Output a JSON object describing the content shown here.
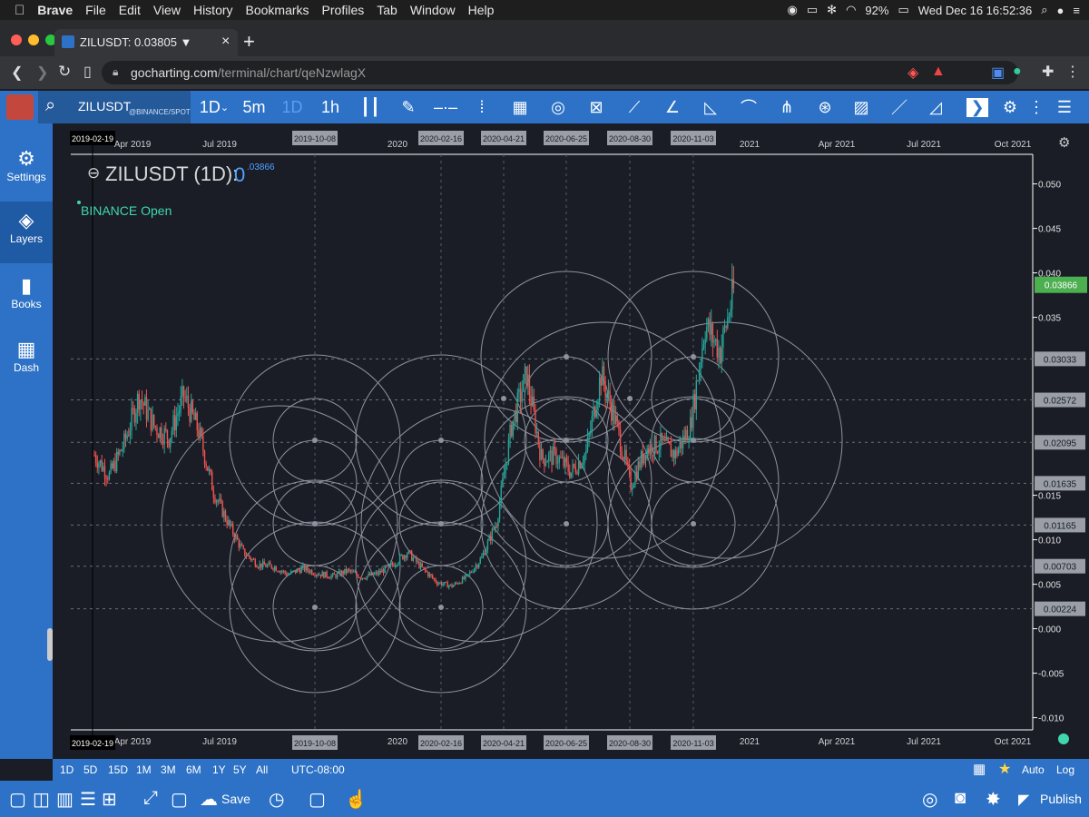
{
  "menubar": {
    "apple": "",
    "app": "Brave",
    "items": [
      "File",
      "Edit",
      "View",
      "History",
      "Bookmarks",
      "Profiles",
      "Tab",
      "Window",
      "Help"
    ],
    "battery": "92%",
    "clock": "Wed Dec 16  16:52:36"
  },
  "tab": {
    "title": "ZILUSDT: 0.03805 ▼",
    "close": "×",
    "new_tab": "+"
  },
  "address": {
    "url_host": "gocharting.com",
    "url_path": "/terminal/chart/qeNzwlagX"
  },
  "toolbar": {
    "symbol": "ZILUSDT",
    "exchange": "@BINANCE/SPOT",
    "interval": "1D",
    "intervals": [
      "5m",
      "1D",
      "1h"
    ]
  },
  "sidebar": {
    "items": [
      {
        "label": "Settings",
        "icon": "gear-icon"
      },
      {
        "label": "Layers",
        "icon": "layers-icon"
      },
      {
        "label": "Books",
        "icon": "book-icon"
      },
      {
        "label": "Dash",
        "icon": "dashboard-icon"
      }
    ]
  },
  "chart": {
    "title": "ZILUSDT (1D):",
    "price_prefix": "0",
    "price_sup": ".03866",
    "source": "BINANCE Open",
    "x_ticks": [
      "Apr 2019",
      "Jul 2019",
      "2020",
      "2021",
      "Apr 2021",
      "Jul 2021",
      "Oct 2021"
    ],
    "date_markers": [
      "2019-02-19",
      "2019-10-08",
      "2020-02-16",
      "2020-04-21",
      "2020-06-25",
      "2020-08-30",
      "2020-11-03"
    ],
    "y_ticks": [
      "0.050",
      "0.045",
      "0.040",
      "0.035",
      "0.015",
      "0.010",
      "0.005",
      "0.000",
      "-0.005",
      "-0.010"
    ],
    "level_labels": [
      "0.03033",
      "0.02572",
      "0.02095",
      "0.01635",
      "0.01165",
      "0.00703",
      "0.00224"
    ],
    "current_price": "0.03866",
    "colors": {
      "up": "#26a69a",
      "down": "#ef5350",
      "accent": "#2d72c6",
      "price_tag": "#4caf50"
    }
  },
  "chart_data": {
    "type": "candlestick",
    "series": [
      {
        "name": "ZILUSDT",
        "values": [
          0.0195,
          0.0172,
          0.0208,
          0.0262,
          0.0228,
          0.0215,
          0.0262,
          0.0222,
          0.0154,
          0.0118,
          0.0086,
          0.0072,
          0.007,
          0.0061,
          0.0068,
          0.0062,
          0.0059,
          0.0065,
          0.0058,
          0.0062,
          0.0072,
          0.0086,
          0.0068,
          0.0052,
          0.0048,
          0.0058,
          0.008,
          0.012,
          0.0228,
          0.0286,
          0.0192,
          0.0194,
          0.0176,
          0.0198,
          0.0286,
          0.0232,
          0.0162,
          0.0202,
          0.0208,
          0.0196,
          0.0228,
          0.0342,
          0.0312,
          0.0386
        ]
      }
    ],
    "ylim": [
      -0.01,
      0.05
    ]
  },
  "bottombar": {
    "ranges": [
      "1D",
      "5D",
      "15D",
      "1M",
      "3M",
      "6M",
      "1Y",
      "5Y",
      "All"
    ],
    "timezone": "UTC-08:00",
    "auto": "Auto",
    "log": "Log"
  },
  "footer": {
    "save": "Save",
    "publish": "Publish"
  }
}
